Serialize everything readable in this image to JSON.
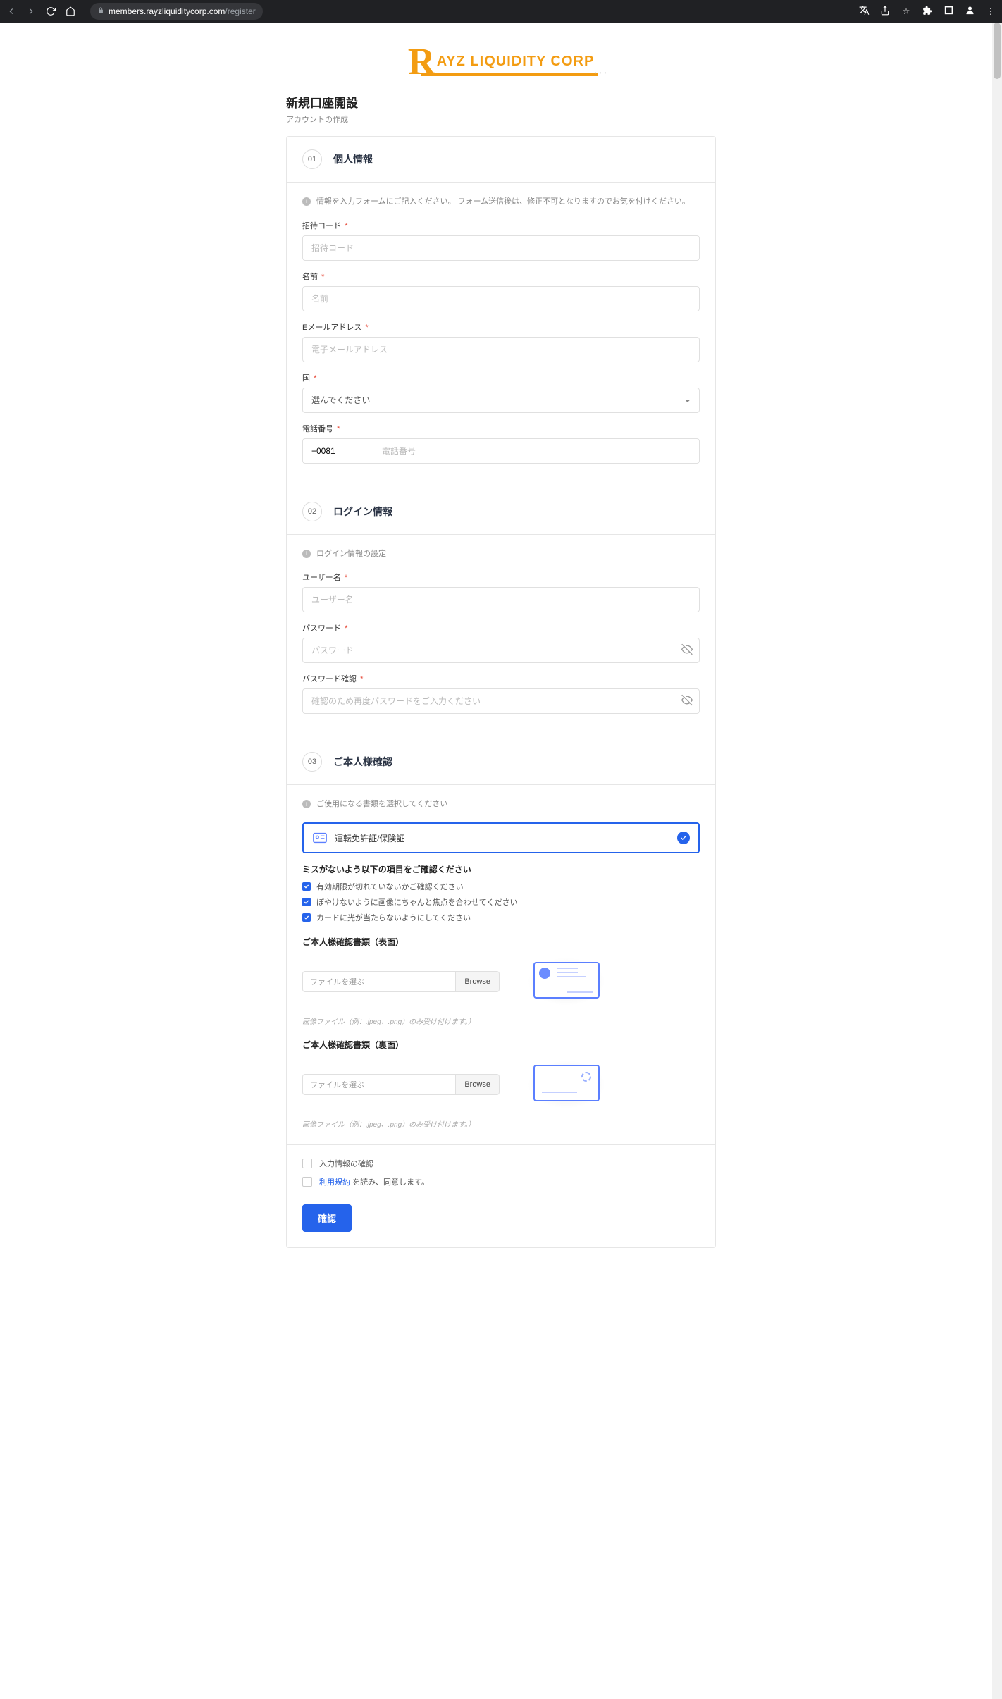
{
  "browser": {
    "url_host": "members.rayzliquiditycorp.com",
    "url_path": "/register"
  },
  "logo": {
    "letter": "R",
    "text": "AYZ LIQUIDITY CORP"
  },
  "header": {
    "title": "新規口座開設",
    "subtitle": "アカウントの作成"
  },
  "section1": {
    "num": "01",
    "title": "個人情報",
    "note": "情報を入力フォームにご記入ください。 フォーム送信後は、修正不可となりますのでお気を付けください。",
    "invite_label": "招待コード",
    "invite_placeholder": "招待コード",
    "name_label": "名前",
    "name_placeholder": "名前",
    "email_label": "Eメールアドレス",
    "email_placeholder": "電子メールアドレス",
    "country_label": "国",
    "country_placeholder": "選んでください",
    "phone_label": "電話番号",
    "phone_prefix": "+0081",
    "phone_placeholder": "電話番号"
  },
  "section2": {
    "num": "02",
    "title": "ログイン情報",
    "note": "ログイン情報の設定",
    "user_label": "ユーザー名",
    "user_placeholder": "ユーザー名",
    "pw_label": "パスワード",
    "pw_placeholder": "パスワード",
    "pwc_label": "パスワード確認",
    "pwc_placeholder": "確認のため再度パスワードをご入力ください"
  },
  "section3": {
    "num": "03",
    "title": "ご本人様確認",
    "note": "ご使用になる書類を選択してください",
    "doc_option": "運転免許証/保険証",
    "checklist_title": "ミスがないよう以下の項目をご確認ください",
    "check1": "有効期限が切れていないかご確認ください",
    "check2": "ぼやけないように画像にちゃんと焦点を合わせてください",
    "check3": "カードに光が当たらないようにしてください",
    "front_title": "ご本人様確認書類（表面）",
    "back_title": "ご本人様確認書類（裏面）",
    "file_placeholder": "ファイルを選ぶ",
    "browse": "Browse",
    "file_hint": "画像ファイル（例：.jpeg、.png）のみ受け付けます。）"
  },
  "final": {
    "confirm1": "入力情報の確認",
    "terms_link": "利用規約",
    "confirm2_suffix": " を読み、同意します。",
    "submit": "確認"
  },
  "req": "*"
}
